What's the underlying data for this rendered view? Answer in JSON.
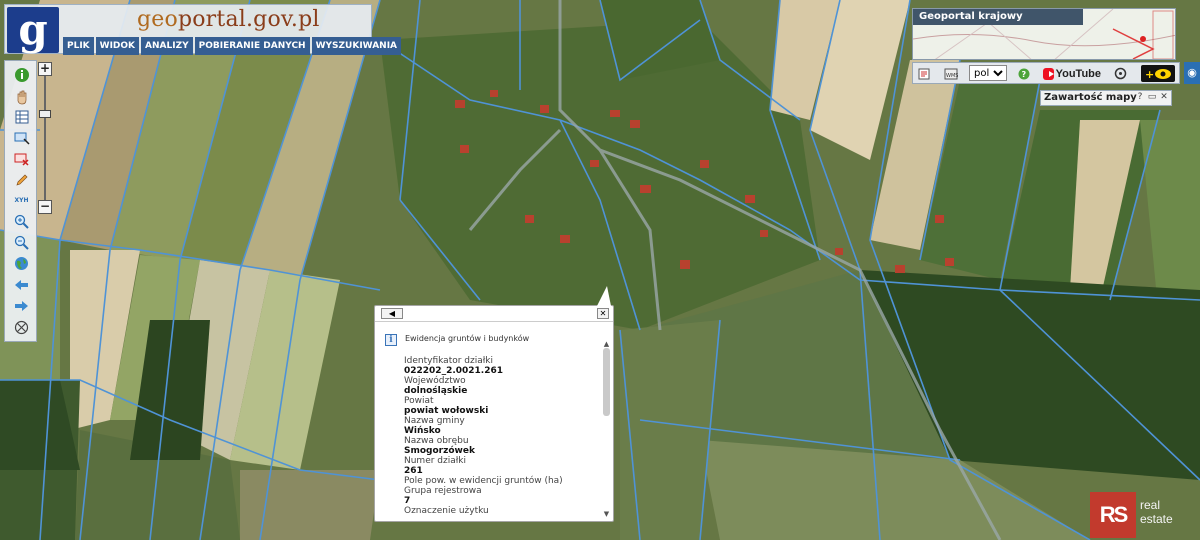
{
  "header": {
    "logo_letter": "g",
    "site_title_prefix": "geo",
    "site_title_main": "portal.gov.pl",
    "menu": [
      {
        "label": "PLIK"
      },
      {
        "label": "WIDOK"
      },
      {
        "label": "ANALIZY"
      },
      {
        "label": "POBIERANIE DANYCH"
      },
      {
        "label": "WYSZUKIWANIA"
      }
    ]
  },
  "zoom": {
    "in": "+",
    "out": "−"
  },
  "left_toolbar": {
    "icons": [
      "info-icon",
      "pan-hand-icon",
      "table-icon",
      "select-rectangle-icon",
      "clear-selection-icon",
      "draw-pencil-icon",
      "coordinates-xy-icon",
      "zoom-in-icon",
      "zoom-out-icon",
      "globe-full-extent-icon",
      "back-arrow-icon",
      "forward-arrow-icon",
      "crosshair-icon"
    ],
    "xy_label": "XYH"
  },
  "overview": {
    "title": "Geoportal krajowy"
  },
  "right_toolbar": {
    "language": "pol",
    "youtube_label": "YouTube"
  },
  "contents_panel": {
    "title": "Zawartość mapy",
    "help": "?",
    "restore": "▭",
    "close": "✕"
  },
  "popup": {
    "back": "◀",
    "close": "✕",
    "info_glyph": "i",
    "title": "Ewidencja gruntów i budynków",
    "fields": [
      {
        "label": "Identyfikator działki",
        "value": "022202_2.0021.261"
      },
      {
        "label": "Województwo",
        "value": "dolnośląskie"
      },
      {
        "label": "Powiat",
        "value": "powiat wołowski"
      },
      {
        "label": "Nazwa gminy",
        "value": "Wińsko"
      },
      {
        "label": "Nazwa obrębu",
        "value": "Smogorzówek"
      },
      {
        "label": "Numer działki",
        "value": "261"
      },
      {
        "label": "Pole pow. w ewidencji gruntów (ha)",
        "value": ""
      },
      {
        "label": "Grupa rejestrowa",
        "value": "7"
      },
      {
        "label": "Oznaczenie użytku",
        "value": ""
      }
    ],
    "scroll_up": "▲",
    "scroll_down": "▼"
  },
  "watermark": {
    "mark": "RS",
    "line1": "real",
    "line2": "estate"
  },
  "colors": {
    "parcel_line": "#4f93d6",
    "menu_bg": "#355e92",
    "logo_bg": "#1c3d8c",
    "watermark": "#c23a2d"
  }
}
